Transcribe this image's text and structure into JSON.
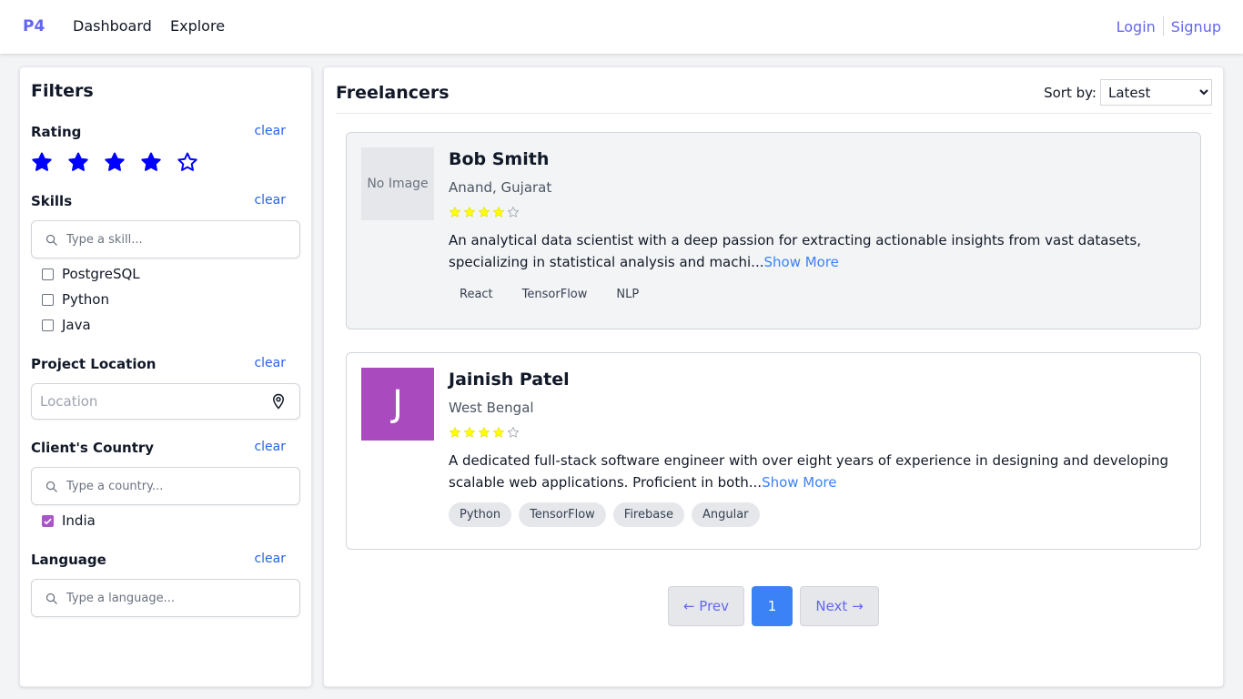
{
  "nav": {
    "brand": "P4",
    "links": [
      "Dashboard",
      "Explore"
    ],
    "login": "Login",
    "signup": "Signup"
  },
  "filters": {
    "title": "Filters",
    "clear_label": "clear",
    "rating": {
      "title": "Rating",
      "value": 4,
      "max": 5,
      "color": "#0000ff"
    },
    "skills": {
      "title": "Skills",
      "placeholder": "Type a skill...",
      "options": [
        "PostgreSQL",
        "Python",
        "Java"
      ]
    },
    "location": {
      "title": "Project Location",
      "placeholder": "Location"
    },
    "country": {
      "title": "Client's Country",
      "placeholder": "Type a country...",
      "options": [
        {
          "label": "India",
          "checked": true
        }
      ]
    },
    "language": {
      "title": "Language",
      "placeholder": "Type a language..."
    }
  },
  "main": {
    "title": "Freelancers",
    "sort_label": "Sort by:",
    "sort_value": "Latest",
    "freelancers": [
      {
        "name": "Bob Smith",
        "location": "Anand, Gujarat",
        "rating": 4,
        "avatar_text": "No Image",
        "description": "An analytical data scientist with a deep passion for extracting actionable insights from vast datasets, specializing in statistical analysis and machi...",
        "more": "Show More",
        "skills": [
          "React",
          "TensorFlow",
          "NLP"
        ]
      },
      {
        "name": "Jainish Patel",
        "location": "West Bengal",
        "rating": 4,
        "avatar_text": "J",
        "description": "A dedicated full-stack software engineer with over eight years of experience in designing and developing scalable web applications. Proficient in both...",
        "more": "Show More",
        "skills": [
          "Python",
          "TensorFlow",
          "Firebase",
          "Angular"
        ]
      }
    ],
    "pagination": {
      "prev": "← Prev",
      "current": "1",
      "next": "Next →"
    }
  },
  "colors": {
    "accent": "#6366f1",
    "link": "#2563eb",
    "star_small": "#ffff00",
    "avatar_bg": "#a94bbf",
    "page_active": "#3b82f6"
  }
}
